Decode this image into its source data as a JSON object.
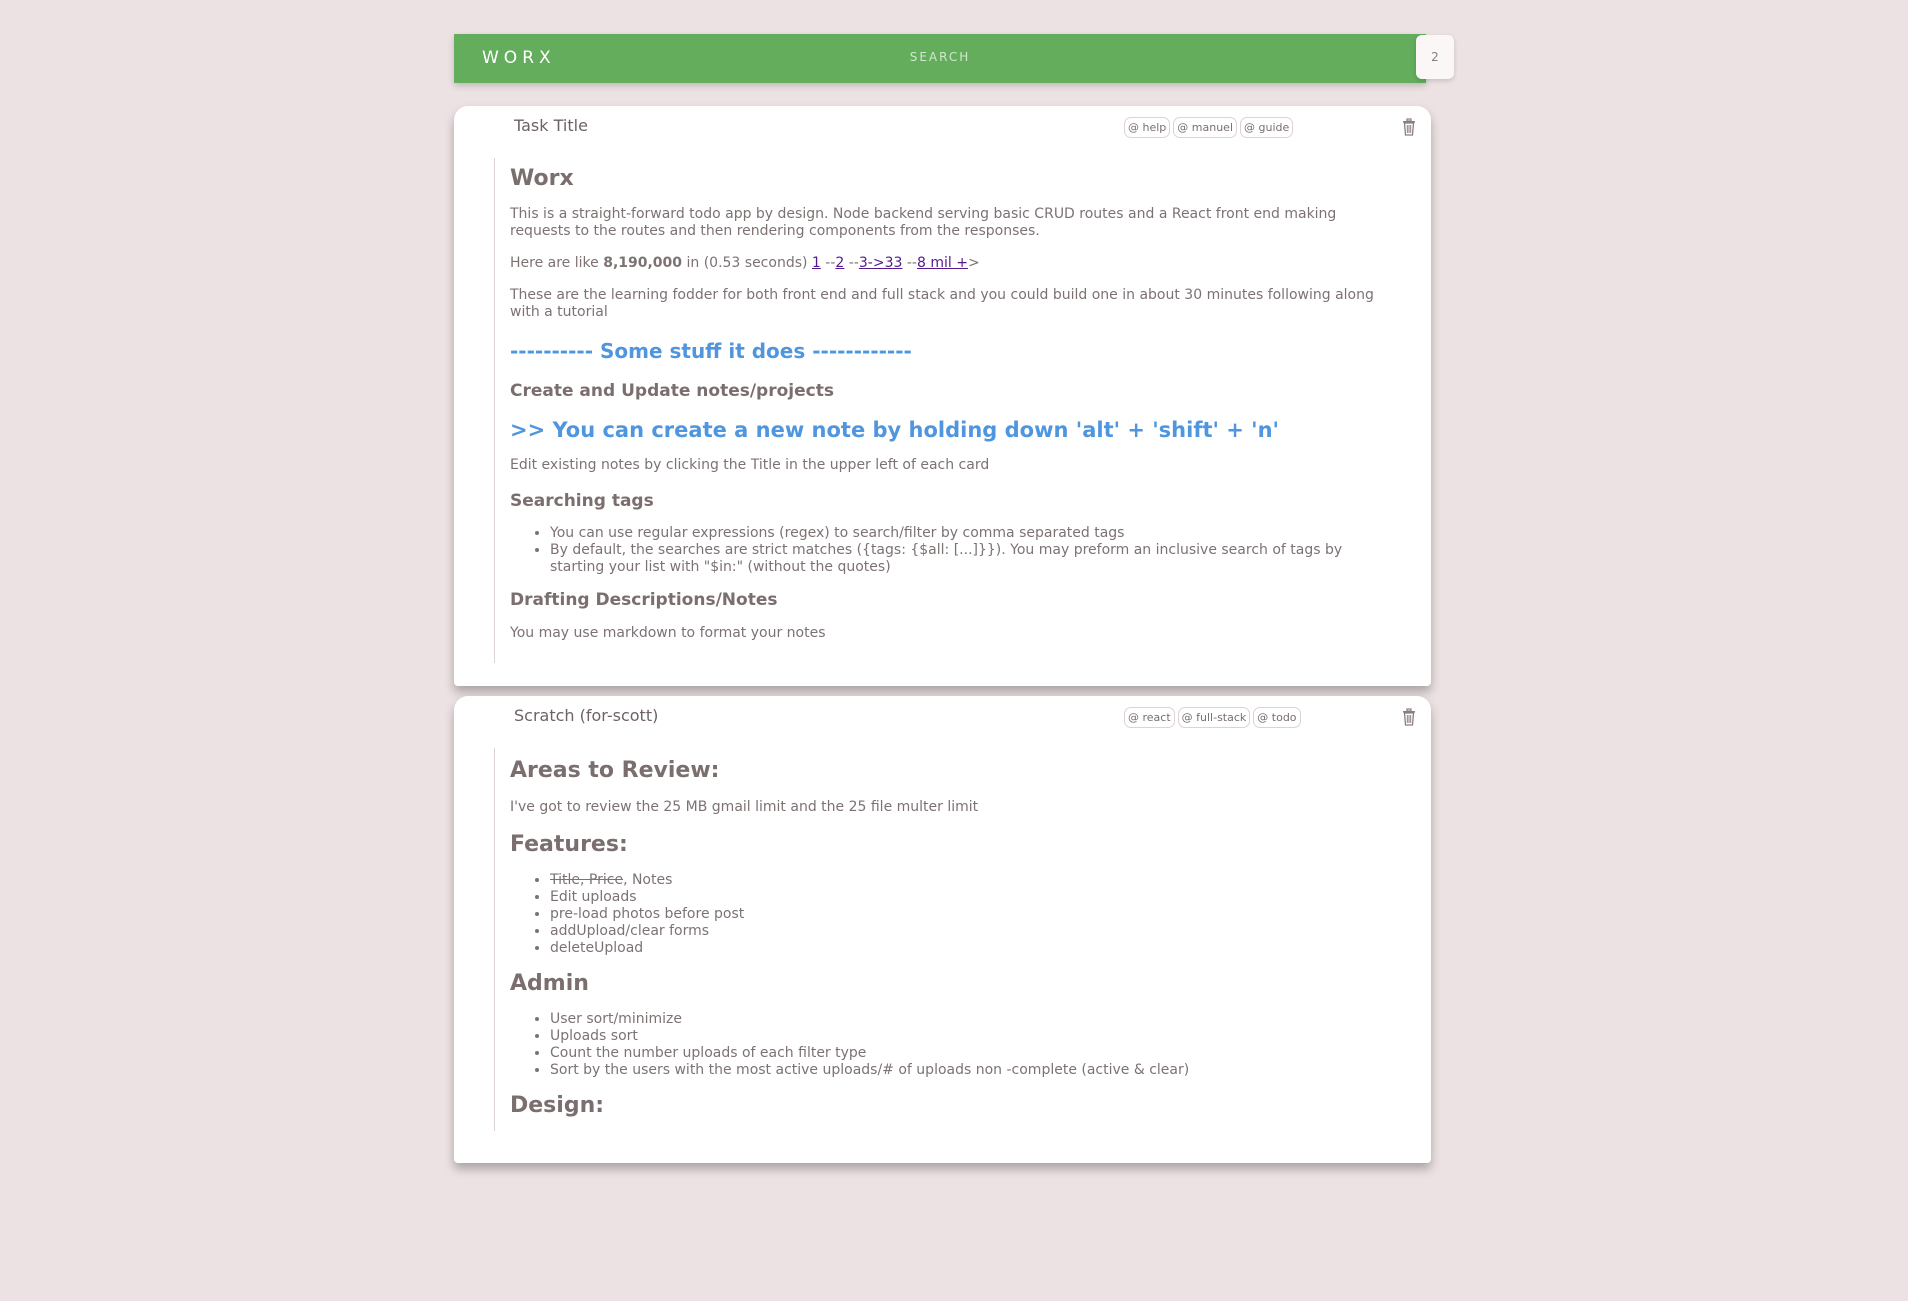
{
  "header": {
    "brand": "WORX",
    "search_placeholder": "SEARCH",
    "count": "2"
  },
  "cards": [
    {
      "title": "Task Title",
      "tags": [
        "@ help",
        "@ manuel",
        "@ guide"
      ],
      "body": {
        "h1": "Worx",
        "p1": "This is a straight-forward todo app by design. Node backend serving basic CRUD routes and a React front end making requests to the routes and then rendering components from the responses.",
        "p2_prefix": "Here are like ",
        "p2_bold": "8,190,000",
        "p2_mid": " in (0.53 seconds) ",
        "p2_links": [
          "1",
          "2",
          "3->33",
          "8 mil +"
        ],
        "p2_sep": " --",
        "p2_end": ">",
        "p3": "These are the learning fodder for both front end and full stack and you could build one in about 30 minutes following along with a tutorial",
        "section_heading": "---------- Some stuff it does ------------",
        "h_create": "Create and Update notes/projects",
        "tip": ">> You can create a new note by holding down 'alt' + 'shift' + 'n'",
        "p_edit": "Edit existing notes by clicking the Title in the upper left of each card",
        "h_search": "Searching tags",
        "search_items": [
          "You can use regular expressions (regex) to search/filter by comma separated tags",
          "By default, the searches are strict matches ({tags: {$all: [...]}}). You may preform an inclusive search of tags by starting your list with \"$in:\" (without the quotes)"
        ],
        "h_draft": "Drafting Descriptions/Notes",
        "p_draft": "You may use markdown to format your notes"
      }
    },
    {
      "title": "Scratch (for-scott)",
      "tags": [
        "@ react",
        "@ full-stack",
        "@ todo"
      ],
      "body": {
        "h_review": "Areas to Review:",
        "p_review": "I've got to review the 25 MB gmail limit and the 25 file multer limit",
        "h_features": "Features:",
        "feature_strike": "Title, Price",
        "feature_first_rest": ", Notes",
        "features": [
          "Edit uploads",
          "pre-load photos before post",
          "addUpload/clear forms",
          "deleteUpload"
        ],
        "h_admin": "Admin",
        "admin": [
          "User sort/minimize",
          "Uploads sort",
          "Count the number uploads of each filter type",
          "Sort by the users with the most active uploads/# of uploads non -complete (active & clear)"
        ],
        "h_design": "Design:"
      }
    }
  ],
  "icons": {
    "delete": "trash-icon"
  }
}
